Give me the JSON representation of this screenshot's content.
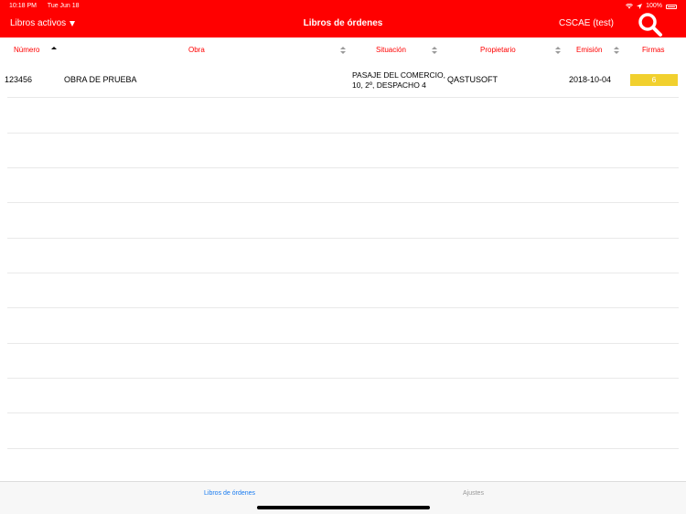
{
  "status": {
    "time": "10:18 PM",
    "date": "Tue Jun 18",
    "battery": "100%"
  },
  "navbar": {
    "filter_label": "Libros activos",
    "title": "Libros de órdenes",
    "user": "CSCAE (test)"
  },
  "columns": {
    "numero": "Número",
    "obra": "Obra",
    "situacion": "Situación",
    "propietario": "Propietario",
    "emision": "Emisión",
    "firmas": "Firmas"
  },
  "rows": [
    {
      "numero": "123456",
      "obra": "OBRA DE PRUEBA",
      "situacion_line1": "PASAJE DEL COMERCIO,",
      "situacion_line2": "10, 2º, DESPACHO 4",
      "propietario": "QASTUSOFT",
      "emision": "2018-10-04",
      "firmas": "6"
    }
  ],
  "tabs": {
    "libros": "Libros de órdenes",
    "ajustes": "Ajustes"
  },
  "colors": {
    "brand": "#ff0000",
    "badge": "#f1d02e",
    "tab_active": "#1a7cf0",
    "tab_inactive": "#999999"
  }
}
